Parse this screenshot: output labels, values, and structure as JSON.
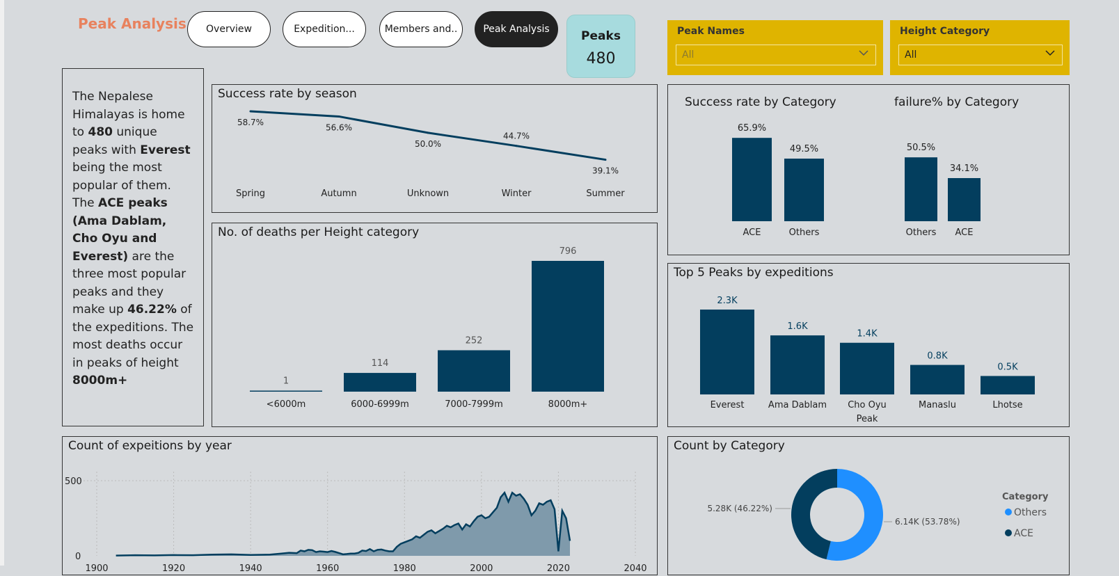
{
  "page_title": "Peak Analysis",
  "nav": [
    {
      "label": "Overview",
      "active": false
    },
    {
      "label": "Expedition...",
      "active": false
    },
    {
      "label": "Members and..",
      "active": false
    },
    {
      "label": "Peak Analysis",
      "active": true
    }
  ],
  "kpi": {
    "label": "Peaks",
    "value": "480"
  },
  "slicers": {
    "peak_names": {
      "label": "Peak Names",
      "value": "All"
    },
    "height_category": {
      "label": "Height Category",
      "value": "All"
    }
  },
  "narrative": {
    "p1": "The Nepalese Himalayas is home to ",
    "peaks": "480",
    "p2": " unique peaks with ",
    "everest": "Everest",
    "p3": " being the most popular of them. The ",
    "ace": "ACE peaks (Ama Dablam, Cho Oyu and Everest)",
    "p4": " are the three most popular peaks and they make up ",
    "pct": "46.22%",
    "p5": " of the expeditions. The most deaths occur in peaks of height ",
    "height": "8000m+"
  },
  "colors": {
    "primary": "#033e5e",
    "accent": "#1f8fff",
    "slicer": "#dfb400",
    "title": "#e8825e",
    "card": "#a7dbde"
  },
  "chart_data": [
    {
      "id": "season",
      "type": "line",
      "title": "Success rate by season",
      "categories": [
        "Spring",
        "Autumn",
        "Unknown",
        "Winter",
        "Summer"
      ],
      "values": [
        58.7,
        56.6,
        50.0,
        44.7,
        39.1
      ],
      "labels": [
        "58.7%",
        "56.6%",
        "50.0%",
        "44.7%",
        "39.1%"
      ]
    },
    {
      "id": "deaths",
      "type": "bar",
      "title": "No. of deaths per Height category",
      "categories": [
        "<6000m",
        "6000-6999m",
        "7000-7999m",
        "8000m+"
      ],
      "values": [
        1,
        114,
        252,
        796
      ],
      "labels": [
        "1",
        "114",
        "252",
        "796"
      ]
    },
    {
      "id": "success_cat",
      "type": "bar",
      "title": "Success rate by Category",
      "categories": [
        "ACE",
        "Others"
      ],
      "values": [
        65.9,
        49.5
      ],
      "labels": [
        "65.9%",
        "49.5%"
      ]
    },
    {
      "id": "failure_cat",
      "type": "bar",
      "title": "failure% by Category",
      "categories": [
        "Others",
        "ACE"
      ],
      "values": [
        50.5,
        34.1
      ],
      "labels": [
        "50.5%",
        "34.1%"
      ]
    },
    {
      "id": "top5",
      "type": "bar",
      "title": "Top 5 Peaks by expeditions",
      "categories": [
        "Everest",
        "Ama Dablam",
        "Cho Oyu Peak",
        "Manaslu",
        "Lhotse"
      ],
      "category_lines": [
        [
          "Everest"
        ],
        [
          "Ama Dablam"
        ],
        [
          "Cho Oyu",
          "Peak"
        ],
        [
          "Manaslu"
        ],
        [
          "Lhotse"
        ]
      ],
      "values": [
        2300,
        1600,
        1400,
        800,
        500
      ],
      "labels": [
        "2.3K",
        "1.6K",
        "1.4K",
        "0.8K",
        "0.5K"
      ]
    },
    {
      "id": "by_year",
      "type": "area",
      "title": "Count of expeitions by year",
      "xlim": [
        1900,
        2040
      ],
      "x_ticks": [
        "1900",
        "1920",
        "1940",
        "1960",
        "1980",
        "2000",
        "2020",
        "2040"
      ],
      "y_ticks": [
        "500",
        "0"
      ],
      "x": [
        1905,
        1910,
        1915,
        1920,
        1925,
        1930,
        1935,
        1940,
        1945,
        1948,
        1950,
        1952,
        1953,
        1954,
        1955,
        1956,
        1957,
        1958,
        1959,
        1960,
        1961,
        1962,
        1963,
        1964,
        1965,
        1966,
        1967,
        1968,
        1969,
        1970,
        1971,
        1972,
        1973,
        1974,
        1975,
        1976,
        1977,
        1978,
        1979,
        1980,
        1981,
        1982,
        1983,
        1984,
        1985,
        1986,
        1987,
        1988,
        1989,
        1990,
        1991,
        1992,
        1993,
        1994,
        1995,
        1996,
        1997,
        1998,
        1999,
        2000,
        2001,
        2002,
        2003,
        2004,
        2005,
        2006,
        2007,
        2008,
        2009,
        2010,
        2011,
        2012,
        2013,
        2014,
        2015,
        2016,
        2017,
        2018,
        2019,
        2020,
        2021,
        2022,
        2023
      ],
      "values": [
        2,
        4,
        3,
        5,
        4,
        8,
        10,
        6,
        8,
        15,
        20,
        18,
        35,
        30,
        40,
        38,
        25,
        30,
        28,
        25,
        32,
        26,
        18,
        10,
        12,
        15,
        15,
        20,
        35,
        32,
        45,
        30,
        40,
        42,
        35,
        30,
        30,
        60,
        80,
        90,
        100,
        110,
        130,
        120,
        140,
        160,
        170,
        150,
        165,
        180,
        200,
        190,
        205,
        215,
        175,
        210,
        195,
        230,
        260,
        270,
        250,
        260,
        290,
        320,
        390,
        420,
        360,
        420,
        400,
        410,
        380,
        340,
        270,
        300,
        350,
        340,
        360,
        370,
        310,
        30,
        300,
        250,
        100
      ]
    },
    {
      "id": "count_cat",
      "type": "pie",
      "title": "Count by Category",
      "legend_title": "Category",
      "series": [
        {
          "name": "Others",
          "value": 6140,
          "label": "6.14K (53.78%)",
          "color": "#1f8fff"
        },
        {
          "name": "ACE",
          "value": 5280,
          "label": "5.28K (46.22%)",
          "color": "#033e5e"
        }
      ]
    }
  ]
}
